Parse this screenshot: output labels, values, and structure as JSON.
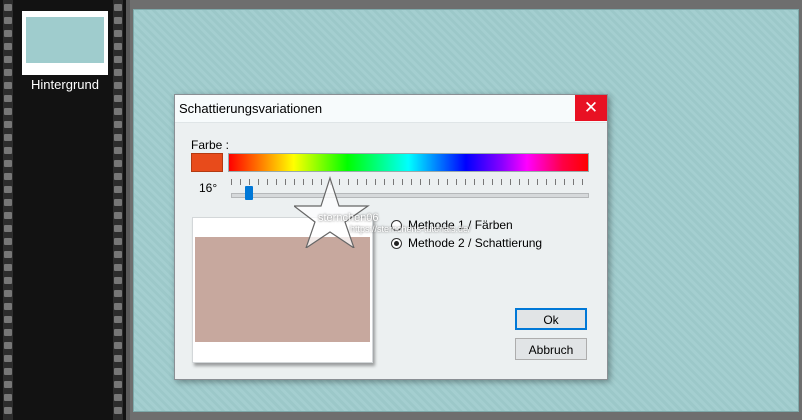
{
  "layers": {
    "items": [
      {
        "label": "Hintergrund"
      }
    ]
  },
  "dialog": {
    "title": "Schattierungsvariationen",
    "close_glyph": "✕",
    "color_label": "Farbe :",
    "degree": "16°",
    "slider_value": 16,
    "methods": [
      {
        "label": "Methode 1 / Färben",
        "selected": false
      },
      {
        "label": "Methode 2 / Schattierung",
        "selected": true
      }
    ],
    "ok_label": "Ok",
    "cancel_label": "Abbruch"
  },
  "colors": {
    "canvas": "#9fcccd",
    "swatch": "#e84b1b",
    "preview": "#c7a89e",
    "accent": "#0078d7",
    "close": "#e81123"
  },
  "watermark": {
    "name": "sternchen06",
    "url": "https://sternchens-tutorials.de/"
  }
}
